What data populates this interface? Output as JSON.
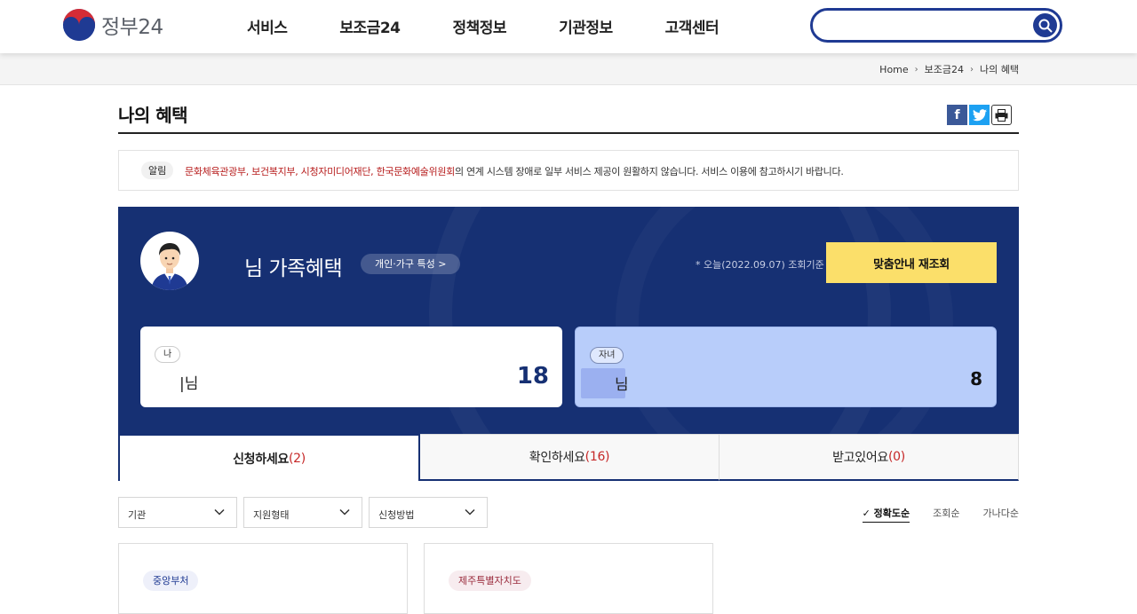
{
  "header": {
    "logo_text": "정부24",
    "nav": [
      "서비스",
      "보조금24",
      "정책정보",
      "기관정보",
      "고객센터"
    ],
    "search_value": "",
    "search_placeholder": ""
  },
  "breadcrumb": [
    "Home",
    "보조금24",
    "나의 혜택"
  ],
  "page_title": "나의 혜택",
  "notice": {
    "tag": "알림",
    "highlight": "문화체육관광부, 보건복지부, 시청자미디어재단, 한국문화예술위원회",
    "message": "의 연계 시스템 장애로 일부 서비스 제공이 원활하지 않습니다. 서비스 이용에 참고하시기 바랍니다."
  },
  "panel": {
    "greeting": "님 가족혜택",
    "chip": "개인·가구 특성 >",
    "basis": "* 오늘(2022.09.07) 조회기준",
    "recheck_button": "맞춤안내 재조회",
    "members": [
      {
        "role": "나",
        "name": "|님",
        "count": "18"
      },
      {
        "role": "자녀",
        "name": "님",
        "count": "8"
      }
    ]
  },
  "tabs": [
    {
      "label": "신청하세요",
      "count": "(2)"
    },
    {
      "label": "확인하세요",
      "count": "(16)"
    },
    {
      "label": "받고있어요",
      "count": "(0)"
    }
  ],
  "filters": [
    "기관",
    "지원형태",
    "신청방법"
  ],
  "sort": [
    "정확도순",
    "조회순",
    "가나다순"
  ],
  "results": [
    {
      "org": "중앙부처"
    },
    {
      "org": "제주특별자치도"
    }
  ],
  "colors": {
    "primary": "#163073",
    "accent_yellow": "#fbdf6a",
    "alert_red": "#b71c1c"
  }
}
